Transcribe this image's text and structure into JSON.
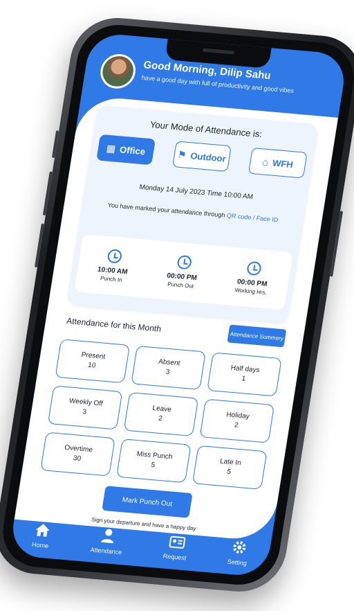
{
  "header": {
    "greeting": "Good Morning, Dilip Sahu",
    "subtitle": "have a good day with full of productivity and good vibes"
  },
  "mode": {
    "title": "Your Mode of Attendance is:",
    "options": [
      {
        "label": "Office",
        "icon": "building-icon",
        "active": true
      },
      {
        "label": "Outdoor",
        "icon": "outdoor-icon",
        "active": false
      },
      {
        "label": "WFH",
        "icon": "home-icon",
        "active": false
      }
    ]
  },
  "date_line": "Monday 14 July 2023  Time 10:00 AM",
  "marked": {
    "text": "You have marked your attendance through",
    "link": "QR code / Face ID"
  },
  "punch": [
    {
      "time": "10:00 AM",
      "label": "Punch In"
    },
    {
      "time": "00:00 PM",
      "label": "Punch Out"
    },
    {
      "time": "00:00 PM",
      "label": "Working Hrs."
    }
  ],
  "month_title": "Attendance for this Month",
  "summary_button": "Attendance Summery",
  "stats": [
    {
      "label": "Present",
      "value": "10"
    },
    {
      "label": "Absent",
      "value": "3"
    },
    {
      "label": "Half days",
      "value": "1"
    },
    {
      "label": "Weekly Off",
      "value": "3"
    },
    {
      "label": "Leave",
      "value": "2"
    },
    {
      "label": "Holiday",
      "value": "2"
    },
    {
      "label": "Overtime",
      "value": "30"
    },
    {
      "label": "Miss Punch",
      "value": "5"
    },
    {
      "label": "Late In",
      "value": "5"
    }
  ],
  "mark_punch_out": "Mark Punch Out",
  "sign_note": "Sign your departure and have a happy day",
  "nav": [
    {
      "label": "Home",
      "icon": "home-icon"
    },
    {
      "label": "Attendance",
      "icon": "user-icon"
    },
    {
      "label": "Request",
      "icon": "id-card-icon"
    },
    {
      "label": "Setting",
      "icon": "gear-icon"
    }
  ],
  "colors": {
    "primary": "#2f7ae6",
    "card_bg": "#eef4fc"
  }
}
